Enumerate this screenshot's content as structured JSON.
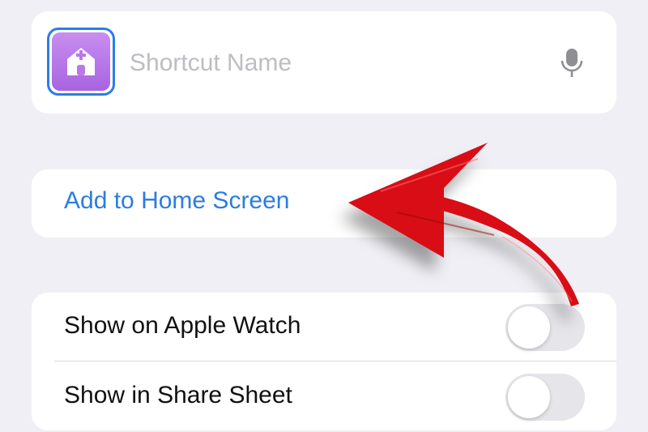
{
  "shortcut": {
    "name_value": "",
    "name_placeholder": "Shortcut Name",
    "icon": "home-plus-icon",
    "icon_color": "#b77ae8",
    "icon_border_color": "#2a7de6"
  },
  "actions": {
    "add_to_home_label": "Add to Home Screen",
    "link_color": "#2b7ddf"
  },
  "settings": {
    "rows": [
      {
        "label": "Show on Apple Watch",
        "enabled": false
      },
      {
        "label": "Show in Share Sheet",
        "enabled": false
      }
    ]
  },
  "annotation": {
    "arrow_color": "#d80f12"
  }
}
